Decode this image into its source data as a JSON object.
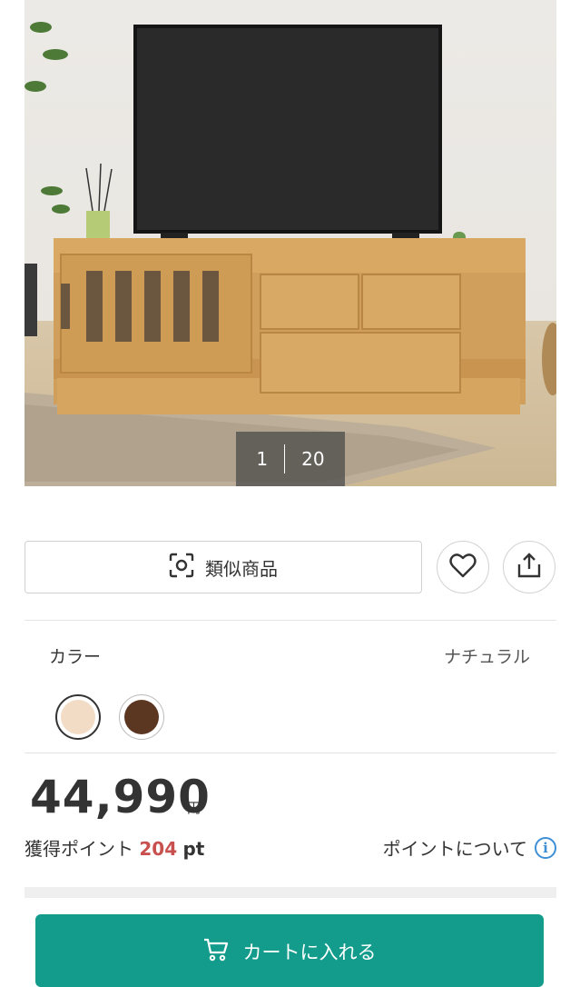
{
  "gallery": {
    "current": "1",
    "total": "20"
  },
  "actions": {
    "similar_label": "類似商品",
    "similar_icon": "scan-icon",
    "favorite_icon": "heart-icon",
    "share_icon": "share-icon"
  },
  "color": {
    "label": "カラー",
    "selected": "ナチュラル",
    "swatches": [
      "#f3dcc5",
      "#5b3620"
    ]
  },
  "price": {
    "amount": "44,990",
    "unit": "円"
  },
  "points": {
    "label": "獲得ポイント",
    "value": "204",
    "unit": "pt",
    "about_label": "ポイントについて",
    "info_icon": "info-icon",
    "info_glyph": "i"
  },
  "cart": {
    "label": "カートに入れる",
    "icon": "cart-icon",
    "color": "#139c8c"
  }
}
